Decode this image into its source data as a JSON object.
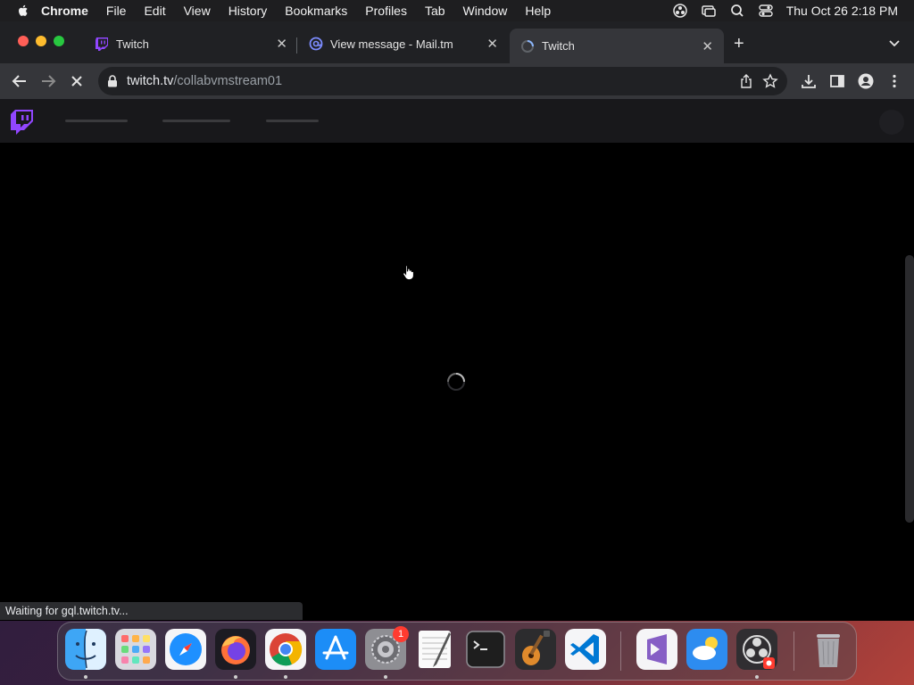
{
  "menubar": {
    "app": "Chrome",
    "items": [
      "File",
      "Edit",
      "View",
      "History",
      "Bookmarks",
      "Profiles",
      "Tab",
      "Window",
      "Help"
    ],
    "clock": "Thu Oct 26  2:18 PM"
  },
  "tabs": [
    {
      "title": "Twitch",
      "favicon": "twitch-icon",
      "active": false
    },
    {
      "title": "View message - Mail.tm",
      "favicon": "mailtm-icon",
      "active": false
    },
    {
      "title": "Twitch",
      "favicon": "loading-icon",
      "active": true
    }
  ],
  "omnibox": {
    "host": "twitch.tv",
    "path": "/collabvmstream01"
  },
  "status": {
    "text": "Waiting for gql.twitch.tv..."
  },
  "dock": {
    "apps": [
      "finder-icon",
      "launchpad-icon",
      "safari-icon",
      "firefox-icon",
      "chrome-icon",
      "app-store-icon",
      "system-settings-icon",
      "textedit-icon",
      "terminal-icon",
      "garageband-icon",
      "vscode-icon",
      "visual-studio-icon",
      "weather-icon",
      "obs-icon",
      "trash-icon"
    ],
    "settings_badge": "1"
  },
  "colors": {
    "twitch_purple": "#9146ff",
    "chrome_dark": "#202124",
    "toolbar": "#35363a"
  }
}
